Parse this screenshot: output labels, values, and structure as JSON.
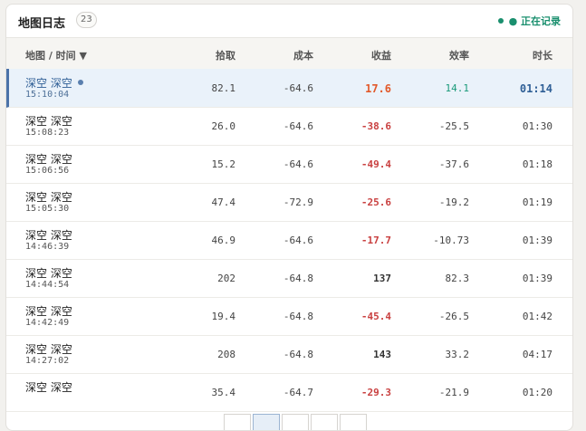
{
  "header": {
    "title": "地图日志",
    "count": "23",
    "recording_label": "● 正在记录",
    "accent_color": "#1a8f6e"
  },
  "columns": {
    "map_time": "地图 / 时间 ▼",
    "pick": "拾取",
    "cost": "成本",
    "gain": "收益",
    "efficiency": "效率",
    "duration": "时长"
  },
  "rows": [
    {
      "name": "深空 深空",
      "time": "15:10:04",
      "pick": "82.1",
      "cost": "-64.6",
      "gain": "17.6",
      "efficiency": "14.1",
      "duration": "01:14",
      "active": true
    },
    {
      "name": "深空 深空",
      "time": "15:08:23",
      "pick": "26.0",
      "cost": "-64.6",
      "gain": "-38.6",
      "efficiency": "-25.5",
      "duration": "01:30"
    },
    {
      "name": "深空 深空",
      "time": "15:06:56",
      "pick": "15.2",
      "cost": "-64.6",
      "gain": "-49.4",
      "efficiency": "-37.6",
      "duration": "01:18"
    },
    {
      "name": "深空 深空",
      "time": "15:05:30",
      "pick": "47.4",
      "cost": "-72.9",
      "gain": "-25.6",
      "efficiency": "-19.2",
      "duration": "01:19"
    },
    {
      "name": "深空 深空",
      "time": "14:46:39",
      "pick": "46.9",
      "cost": "-64.6",
      "gain": "-17.7",
      "efficiency": "-10.73",
      "duration": "01:39"
    },
    {
      "name": "深空 深空",
      "time": "14:44:54",
      "pick": "202",
      "cost": "-64.8",
      "gain": "137",
      "efficiency": "82.3",
      "duration": "01:39"
    },
    {
      "name": "深空 深空",
      "time": "14:42:49",
      "pick": "19.4",
      "cost": "-64.8",
      "gain": "-45.4",
      "efficiency": "-26.5",
      "duration": "01:42"
    },
    {
      "name": "深空 深空",
      "time": "14:27:02",
      "pick": "208",
      "cost": "-64.8",
      "gain": "143",
      "efficiency": "33.2",
      "duration": "04:17"
    },
    {
      "name": "深空 深空",
      "time": "",
      "pick": "35.4",
      "cost": "-64.7",
      "gain": "-29.3",
      "efficiency": "-21.9",
      "duration": "01:20"
    }
  ]
}
